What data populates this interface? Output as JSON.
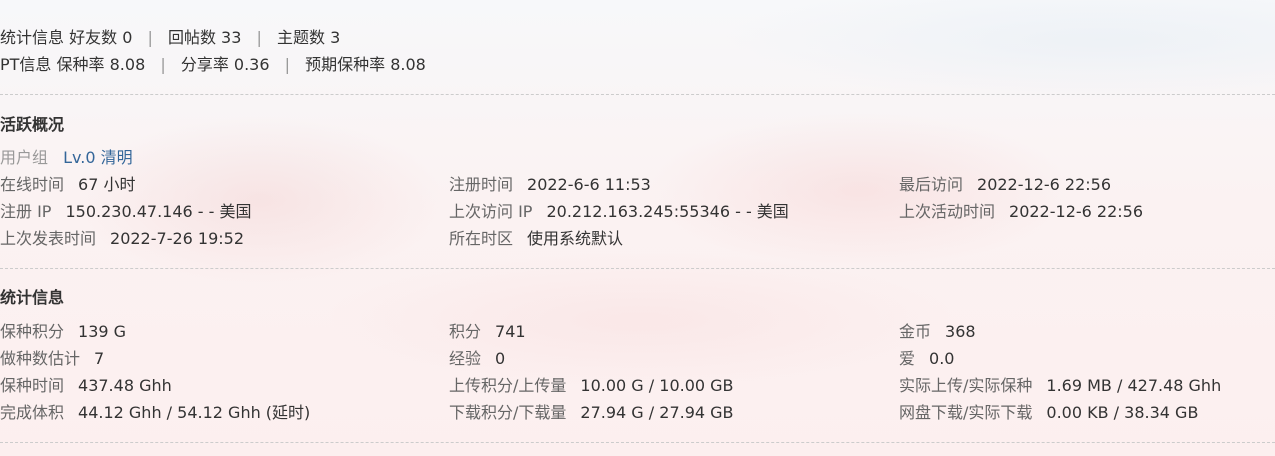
{
  "summary": {
    "line1": {
      "label": "统计信息",
      "items": [
        "好友数 0",
        "回帖数 33",
        "主题数 3"
      ],
      "separator": "|"
    },
    "line2": {
      "label": "PT信息",
      "items": [
        "保种率 8.08",
        "分享率 0.36",
        "预期保种率 8.08"
      ],
      "separator": "|"
    }
  },
  "activity": {
    "title": "活跃概况",
    "usergroup": {
      "label": "用户组",
      "value": "Lv.0 清明"
    },
    "rows": [
      [
        {
          "label": "在线时间",
          "value": "67 小时"
        },
        {
          "label": "注册时间",
          "value": "2022-6-6 11:53"
        },
        {
          "label": "最后访问",
          "value": "2022-12-6 22:56"
        }
      ],
      [
        {
          "label": "注册 IP",
          "value": "150.230.47.146 - - 美国"
        },
        {
          "label": "上次访问 IP",
          "value": "20.212.163.245:55346 - - 美国"
        },
        {
          "label": "上次活动时间",
          "value": "2022-12-6 22:56"
        }
      ],
      [
        {
          "label": "上次发表时间",
          "value": "2022-7-26 19:52"
        },
        {
          "label": "所在时区",
          "value": "使用系统默认"
        },
        {
          "label": "",
          "value": ""
        }
      ]
    ]
  },
  "stats": {
    "title": "统计信息",
    "rows": [
      [
        {
          "label": "保种积分",
          "value": "139 G"
        },
        {
          "label": "积分",
          "value": "741"
        },
        {
          "label": "金币",
          "value": "368"
        }
      ],
      [
        {
          "label": "做种数估计",
          "value": "7"
        },
        {
          "label": "经验",
          "value": "0"
        },
        {
          "label": "爱",
          "value": "0.0"
        }
      ],
      [
        {
          "label": "保种时间",
          "value": "437.48 Ghh"
        },
        {
          "label": "上传积分/上传量",
          "value": "10.00 G / 10.00 GB"
        },
        {
          "label": "实际上传/实际保种",
          "value": "1.69 MB / 427.48 Ghh"
        }
      ],
      [
        {
          "label": "完成体积",
          "value": "44.12 Ghh / 54.12 Ghh (延时)"
        },
        {
          "label": "下载积分/下载量",
          "value": "27.94 G / 27.94 GB"
        },
        {
          "label": "网盘下载/实际下载",
          "value": "0.00 KB / 38.34 GB"
        }
      ]
    ]
  },
  "colors": {
    "text": "#333333",
    "label": "#666666",
    "link": "#336699",
    "separator": "#999999"
  }
}
